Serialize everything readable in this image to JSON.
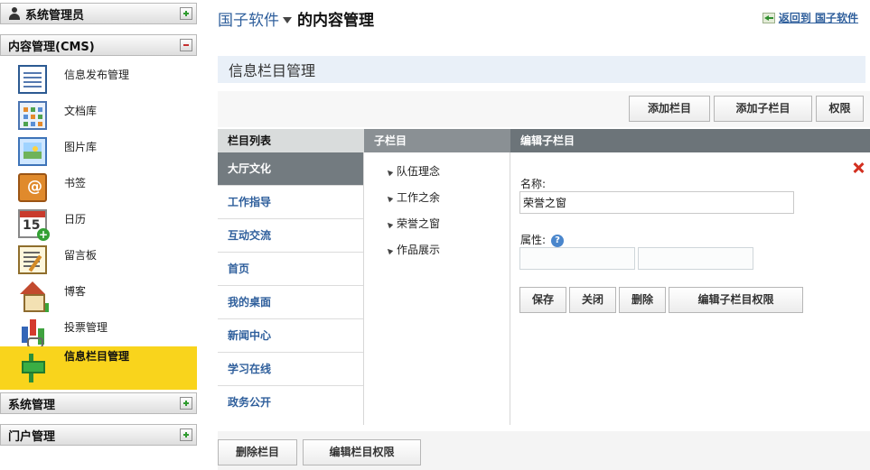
{
  "sidebar": {
    "panel_admin": "系统管理员",
    "panel_cms": "内容管理(CMS)",
    "panel_system": "系统管理",
    "panel_portal": "门户管理",
    "items": [
      {
        "label": "信息发布管理",
        "icon": "document-icon"
      },
      {
        "label": "文档库",
        "icon": "grid-icon"
      },
      {
        "label": "图片库",
        "icon": "picture-icon"
      },
      {
        "label": "书签",
        "icon": "address-book-icon"
      },
      {
        "label": "日历",
        "icon": "calendar-icon"
      },
      {
        "label": "留言板",
        "icon": "notepad-icon"
      },
      {
        "label": "博客",
        "icon": "house-icon"
      },
      {
        "label": "投票管理",
        "icon": "chart-icon"
      },
      {
        "label": "信息栏目管理",
        "icon": "signpost-icon"
      }
    ],
    "calendar_number": "15",
    "active_index": 8,
    "active_color": "#f9d41c"
  },
  "header": {
    "site_name": "国子软件",
    "title_suffix": "的内容管理",
    "back_link": "返回到 国子软件"
  },
  "section_title": "信息栏目管理",
  "toolbar": {
    "add_category": "添加栏目",
    "add_subcategory": "添加子栏目",
    "permissions": "权限"
  },
  "columns": {
    "category_list": "栏目列表",
    "subcategory": "子栏目",
    "edit_subcategory": "编辑子栏目"
  },
  "categories": [
    "大厅文化",
    "工作指导",
    "互动交流",
    "首页",
    "我的桌面",
    "新闻中心",
    "学习在线",
    "政务公开"
  ],
  "active_category": 0,
  "subcategories": [
    "队伍理念",
    "工作之余",
    "荣誉之窗",
    "作品展示"
  ],
  "edit_form": {
    "name_label": "名称:",
    "name_value": "荣誉之窗",
    "attr_label": "属性:",
    "help_glyph": "?",
    "attr_value_1": "",
    "attr_value_2": "",
    "save": "保存",
    "close": "关闭",
    "delete": "删除",
    "edit_perm": "编辑子栏目权限"
  },
  "bottom": {
    "delete_category": "删除栏目",
    "edit_category_perm": "编辑栏目权限"
  }
}
